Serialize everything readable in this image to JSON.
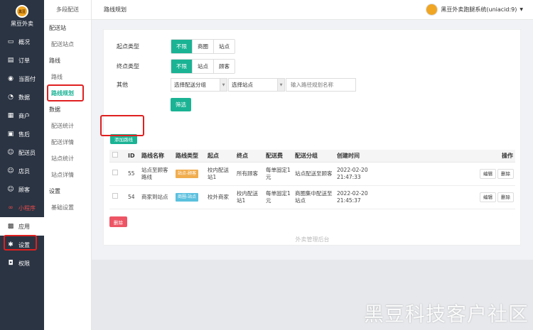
{
  "brand": {
    "logo_text": "黑豆",
    "name": "黑豆外卖"
  },
  "sidebar": {
    "items": [
      {
        "label": "概况",
        "icon": "monitor-icon"
      },
      {
        "label": "订单",
        "icon": "order-icon"
      },
      {
        "label": "当面付",
        "icon": "pay-icon"
      },
      {
        "label": "数据",
        "icon": "data-icon"
      },
      {
        "label": "商户",
        "icon": "store-icon"
      },
      {
        "label": "售后",
        "icon": "aftersale-icon"
      },
      {
        "label": "配送员",
        "icon": "rider-icon"
      },
      {
        "label": "店员",
        "icon": "clerk-icon"
      },
      {
        "label": "顾客",
        "icon": "customer-icon"
      },
      {
        "label": "小程序",
        "icon": "miniprogram-icon"
      },
      {
        "label": "应用",
        "icon": "apps-icon"
      },
      {
        "label": "设置",
        "icon": "settings-icon"
      },
      {
        "label": "权限",
        "icon": "lock-icon"
      }
    ]
  },
  "submenu": {
    "head": "多段配送",
    "groups": [
      {
        "title": "配送站",
        "items": [
          "配送站点"
        ]
      },
      {
        "title": "路线",
        "items": [
          "路线",
          "路线规划"
        ]
      },
      {
        "title": "数据",
        "items": [
          "配送统计",
          "配送详情",
          "站点统计",
          "站点详情"
        ]
      },
      {
        "title": "设置",
        "items": [
          "基础设置"
        ]
      }
    ]
  },
  "topbar": {
    "title": "路线规划",
    "user": "黑豆外卖跑腿系统(uniacid:9)"
  },
  "filters": {
    "start_label": "起点类型",
    "start_options": [
      "不限",
      "商圈",
      "站点"
    ],
    "end_label": "终点类型",
    "end_options": [
      "不限",
      "站点",
      "顾客"
    ],
    "other_label": "其他",
    "group_select": "选择配送分组",
    "station_select": "选择站点",
    "route_placeholder": "输入路径规划名称",
    "filter_button": "筛选"
  },
  "add_button": "添加路线",
  "table": {
    "headers": [
      "ID",
      "路线名称",
      "路线类型",
      "起点",
      "终点",
      "配送费",
      "配送分组",
      "创建时间",
      "操作"
    ],
    "rows": [
      {
        "id": "55",
        "name": "站点至顾客路线",
        "type": "站点-顾客",
        "type_color": "orange",
        "start": "校内配送站1",
        "end": "所有顾客",
        "fee": "每单固定1元",
        "group": "站点配送至顾客",
        "time": "2022-02-20 21:47:33"
      },
      {
        "id": "54",
        "name": "商家到站点",
        "type": "商圈-站点",
        "type_color": "blue",
        "start": "校外商家",
        "end": "校内配送站1",
        "fee": "每单固定1元",
        "group": "商圈集中配送至站点",
        "time": "2022-02-20 21:45:37"
      }
    ],
    "edit": "编辑",
    "delete": "删除"
  },
  "delete_button": "删除",
  "footer": "外卖管理后台",
  "watermark": "黑豆科技客户社区",
  "colors": {
    "accent": "#1ab394",
    "sidebar": "#2b3443",
    "danger": "#ed5565",
    "highlight": "#e02020"
  }
}
